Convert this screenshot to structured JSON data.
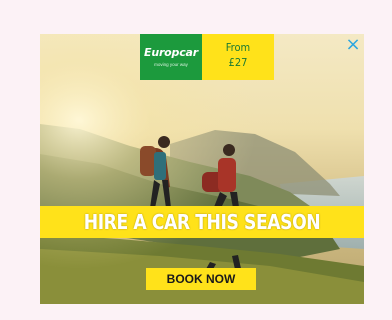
{
  "ad": {
    "brand": "Europcar",
    "brand_tagline": "moving your way",
    "price_line1": "From",
    "price_line2": "£27",
    "headline": "HIRE A CAR THIS SEASON",
    "cta_label": "BOOK NOW",
    "close_icon": "×"
  },
  "colors": {
    "brand_green": "#1c9a3d",
    "accent_yellow": "#ffe21a",
    "close_blue": "#2aa6e0",
    "page_background": "#fcf2f6"
  }
}
